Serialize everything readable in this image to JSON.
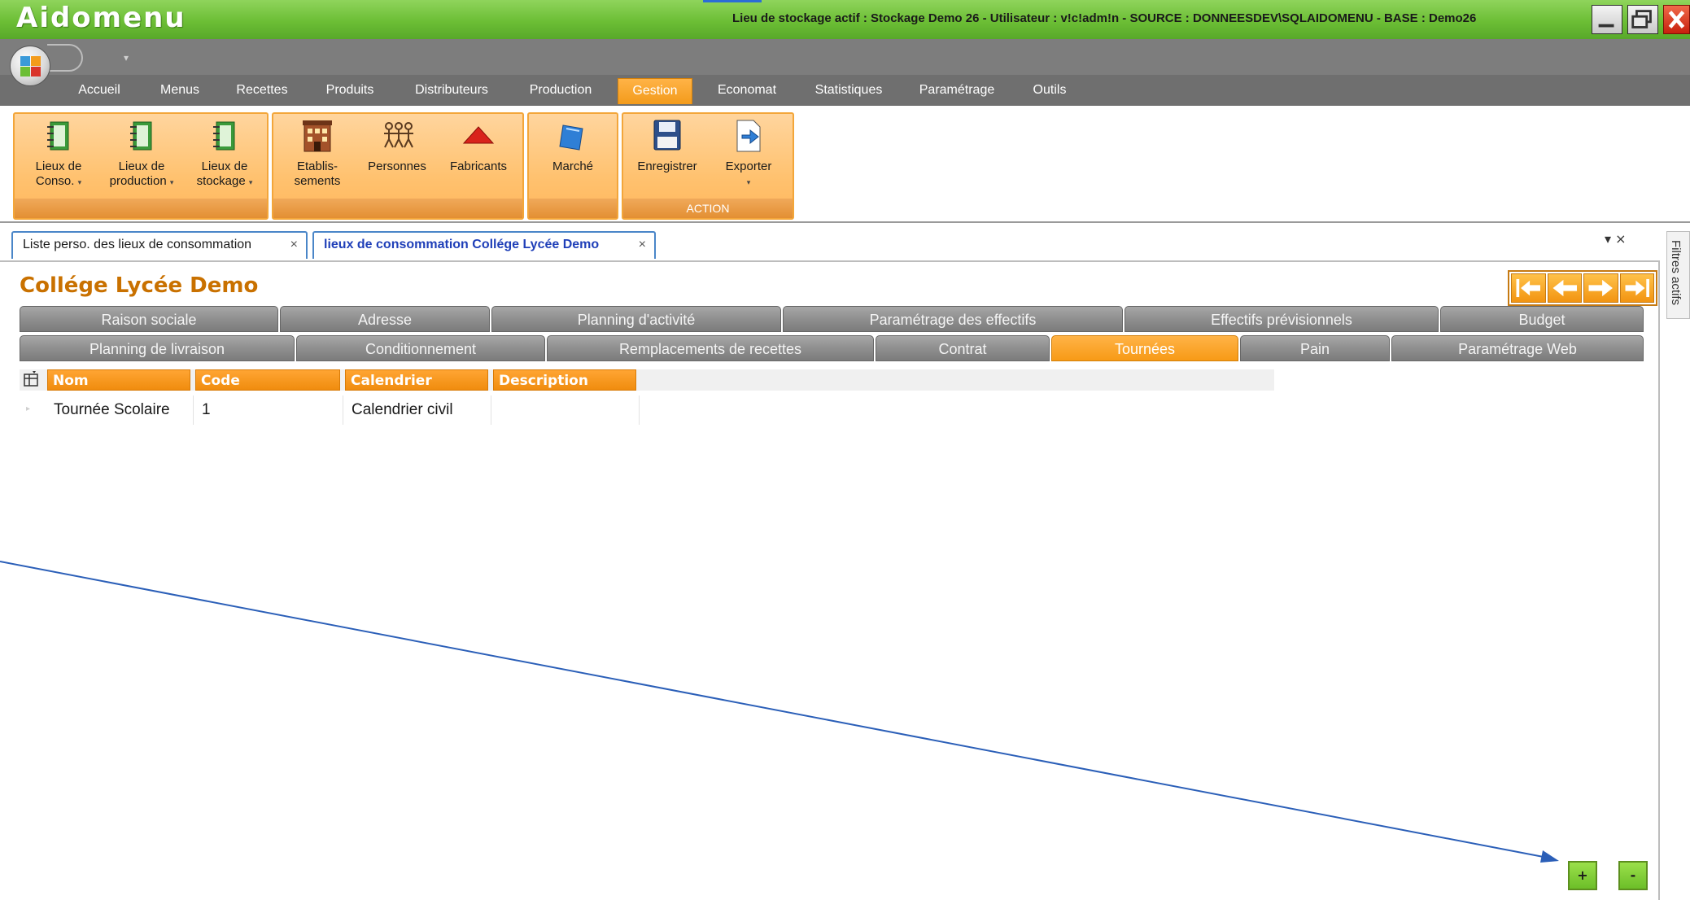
{
  "app": {
    "title": "Aidomenu",
    "status": "Lieu de stockage actif : Stockage Demo 26 - Utilisateur : v!c!adm!n - SOURCE : DONNEESDEV\\SQLAIDOMENU - BASE : Demo26"
  },
  "ribbon_tabs": [
    {
      "label": "Accueil"
    },
    {
      "label": "Menus"
    },
    {
      "label": "Recettes"
    },
    {
      "label": "Produits"
    },
    {
      "label": "Distributeurs"
    },
    {
      "label": "Production"
    },
    {
      "label": "Gestion",
      "active": true
    },
    {
      "label": "Economat"
    },
    {
      "label": "Statistiques"
    },
    {
      "label": "Paramétrage"
    },
    {
      "label": "Outils"
    }
  ],
  "ribbon": {
    "lieux_conso": {
      "line1": "Lieux de",
      "line2": "Conso.",
      "icon": "notebook-icon"
    },
    "lieux_production": {
      "line1": "Lieux de",
      "line2": "production",
      "icon": "notebook-icon"
    },
    "lieux_stockage": {
      "line1": "Lieux de",
      "line2": "stockage",
      "icon": "notebook-icon"
    },
    "etablissements": {
      "line1": "Etablis-",
      "line2": "sements",
      "icon": "building-icon"
    },
    "personnes": {
      "label": "Personnes",
      "icon": "people-icon"
    },
    "fabricants": {
      "label": "Fabricants",
      "icon": "factory-roof-icon"
    },
    "marche": {
      "label": "Marché",
      "icon": "market-icon"
    },
    "enregistrer": {
      "label": "Enregistrer",
      "icon": "floppy-disk-icon"
    },
    "exporter": {
      "label": "Exporter",
      "icon": "export-icon"
    },
    "action_group_label": "ACTION"
  },
  "doc_tabs": [
    {
      "label": "Liste perso. des lieux de consommation",
      "close": "×"
    },
    {
      "label": "lieux de consommation Collége Lycée Demo",
      "close": "×",
      "active": true
    }
  ],
  "strip_controls": "▾ ×",
  "side_panel": {
    "label": "Filtres actifs"
  },
  "record": {
    "title": "Collége Lycée Demo"
  },
  "sub_tabs_row1": [
    {
      "label": "Raison sociale"
    },
    {
      "label": "Adresse"
    },
    {
      "label": "Planning d'activité"
    },
    {
      "label": "Paramétrage des effectifs"
    },
    {
      "label": "Effectifs prévisionnels"
    },
    {
      "label": "Budget"
    }
  ],
  "sub_tabs_row2": [
    {
      "label": "Planning de livraison"
    },
    {
      "label": "Conditionnement"
    },
    {
      "label": "Remplacements de recettes"
    },
    {
      "label": "Contrat"
    },
    {
      "label": "Tournées",
      "active": true
    },
    {
      "label": "Pain"
    },
    {
      "label": "Paramétrage Web"
    }
  ],
  "grid": {
    "columns": [
      "Nom",
      "Code",
      "Calendrier",
      "Description"
    ],
    "rows": [
      [
        "Tournée Scolaire",
        "1",
        "Calendrier civil",
        ""
      ]
    ]
  },
  "buttons": {
    "add": "+",
    "remove": "-"
  },
  "colors": {
    "accent_orange": "#f39b1b",
    "title_green": "#6cbe35",
    "annotation_line": "#2b5fb8"
  }
}
